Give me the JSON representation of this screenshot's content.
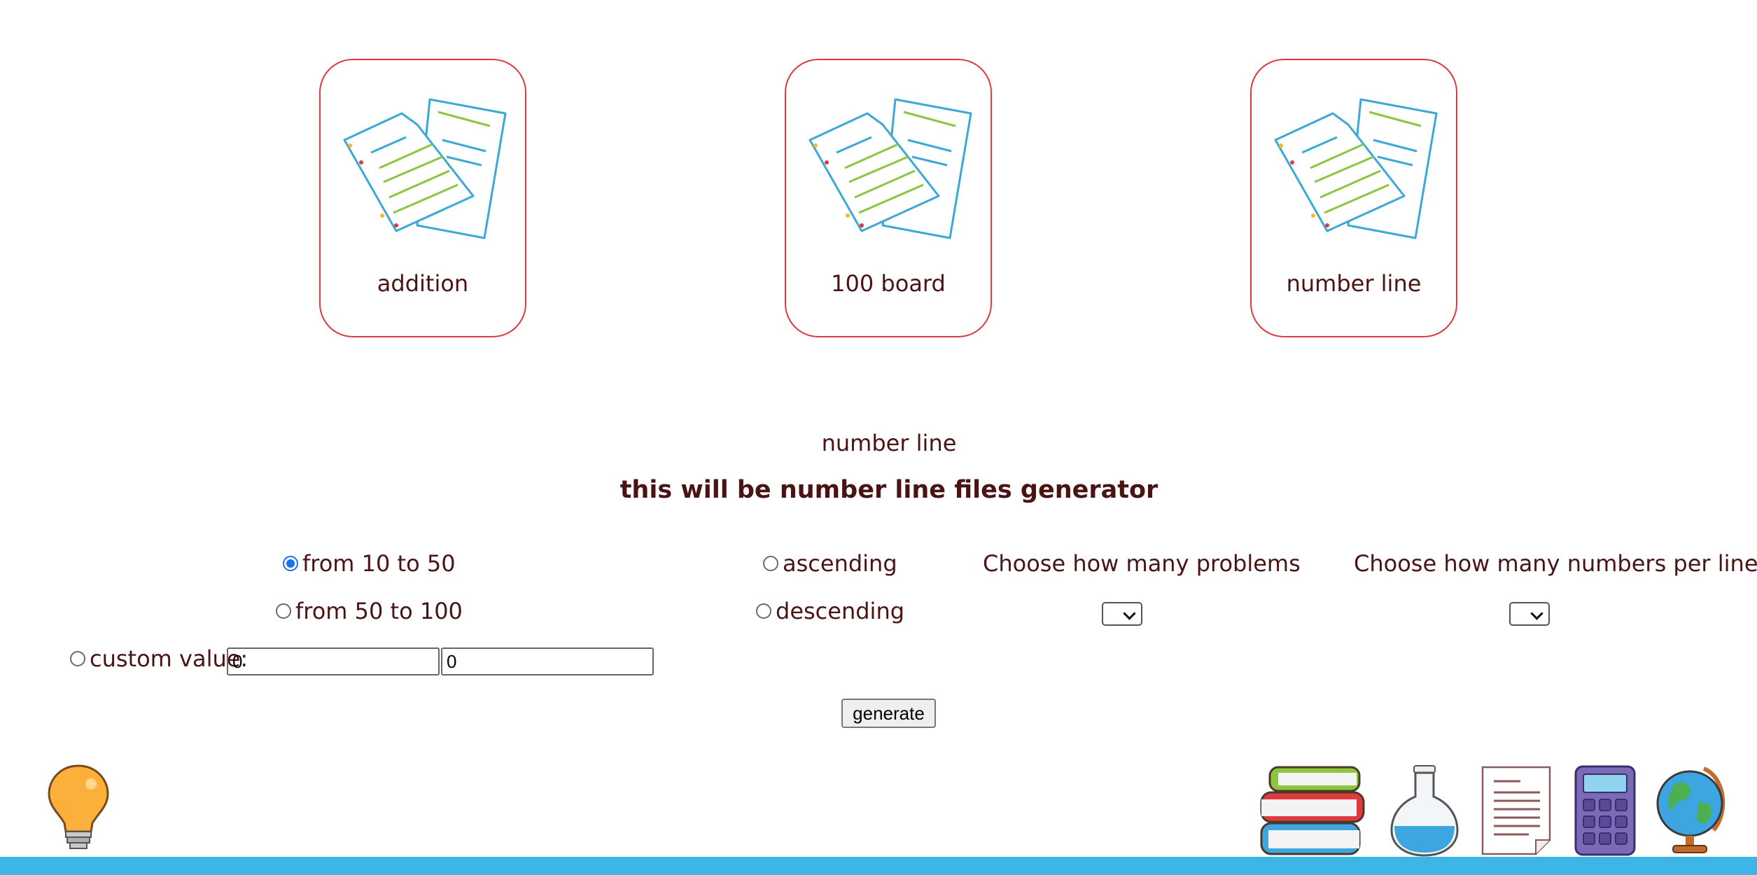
{
  "cards": [
    {
      "label": "addition",
      "icon": "documents-icon"
    },
    {
      "label": "100 board",
      "icon": "documents-icon"
    },
    {
      "label": "number line",
      "icon": "documents-icon"
    }
  ],
  "section": {
    "subheading": "number line",
    "heading": "this will be number line files generator"
  },
  "range_options": [
    {
      "label": "from 10 to 50",
      "checked": true
    },
    {
      "label": "from 50 to 100",
      "checked": false
    },
    {
      "label": "custom value:",
      "checked": false
    }
  ],
  "custom_values": [
    "0",
    "0"
  ],
  "order_options": [
    {
      "label": "ascending",
      "checked": false
    },
    {
      "label": "descending",
      "checked": false
    }
  ],
  "problems": {
    "label": "Choose how many problems",
    "selected": ""
  },
  "numbers_per_line": {
    "label": "Choose how many numbers per lines",
    "selected": ""
  },
  "generate_label": "generate",
  "colors": {
    "accent_border": "#e0393e",
    "text": "#4a1414",
    "footer": "#3db6e6",
    "radio_checked": "#1a73e8"
  },
  "footer_icons": [
    "lightbulb-icon",
    "books-icon",
    "flask-icon",
    "document-icon",
    "calculator-icon",
    "globe-icon"
  ]
}
